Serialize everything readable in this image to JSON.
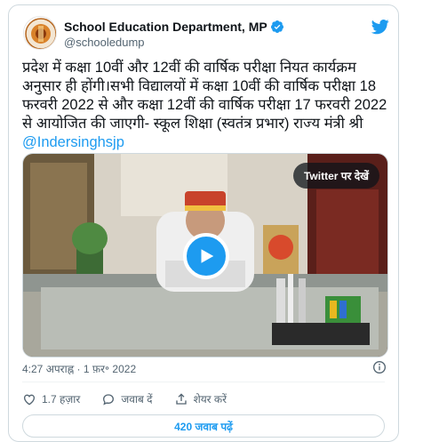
{
  "author": {
    "display_name": "School Education Department, MP",
    "handle": "@schooledump"
  },
  "tweet": {
    "text": "प्रदेश में कक्षा 10वीं और 12वीं की वार्षिक परीक्षा नियत कार्यक्रम अनुसार ही होंगी।सभी विद्यालयों में कक्षा 10वीं की वार्षिक परीक्षा 18 फरवरी 2022 से और कक्षा 12वीं की वार्षिक परीक्षा 17 फरवरी 2022 से आयोजित की जाएगी- स्कूल शिक्षा (स्वतंत्र प्रभार) राज्य मंत्री श्री ",
    "mention": "@Indersinghsjp",
    "timestamp": "4:27 अपराह्न · 1 फ़र॰ 2022"
  },
  "media": {
    "watch_label": "Twitter पर देखें"
  },
  "actions": {
    "likes": "1.7 हज़ार",
    "reply_label": "जवाब दें",
    "share_label": "शेयर करें"
  },
  "replies_button": "420 जवाब पढ़ें",
  "colors": {
    "accent": "#1d9bf0",
    "text": "#0f1419",
    "muted": "#536471"
  },
  "icons": [
    "verified-badge-icon",
    "twitter-bird-icon",
    "play-icon",
    "info-icon",
    "heart-icon",
    "reply-bubble-icon",
    "share-icon"
  ]
}
